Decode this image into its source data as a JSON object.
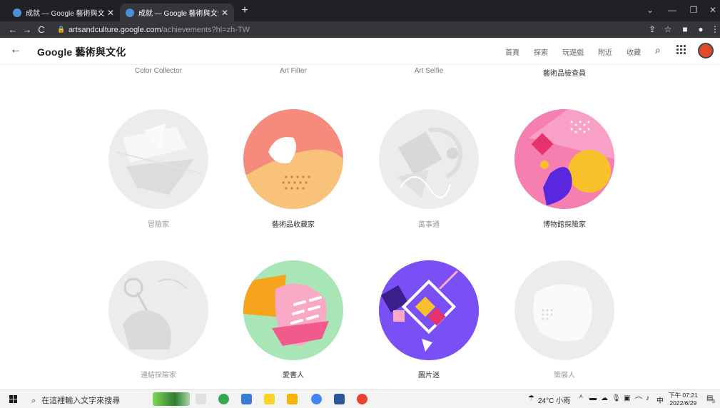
{
  "browser": {
    "tabs": [
      {
        "title": "成就 — Google 藝術與文化",
        "active": false
      },
      {
        "title": "成就 — Google 藝術與文化",
        "active": true
      }
    ],
    "new_tab": "+",
    "url_host": "artsandculture.google.com",
    "url_path": "/achievements?hl=zh-TW"
  },
  "site": {
    "brand": "Google 藝術與文化",
    "nav": [
      "首頁",
      "探索",
      "玩遊戲",
      "附近",
      "收藏"
    ]
  },
  "achievements_top_row": [
    "Color Collector",
    "Art Filter",
    "Art Selfie",
    "藝術品檢查員"
  ],
  "achievements_row1": [
    {
      "name": "冒險家",
      "earned": false
    },
    {
      "name": "藝術品收藏家",
      "earned": true
    },
    {
      "name": "萬事通",
      "earned": false
    },
    {
      "name": "博物館探險家",
      "earned": true
    }
  ],
  "achievements_row2": [
    {
      "name": "連結探險家",
      "earned": false
    },
    {
      "name": "愛書人",
      "earned": true
    },
    {
      "name": "圖片迷",
      "earned": true
    },
    {
      "name": "策展人",
      "earned": false
    }
  ],
  "taskbar": {
    "search_placeholder": "在這裡輸入文字來搜尋",
    "weather": "24°C 小雨",
    "ime": "中",
    "time": "下午 07:21",
    "date": "2022/6/29",
    "notification_count": "3"
  },
  "colors": {
    "tab_bg": "#202124",
    "omnibar_bg": "#35363a",
    "taskbar_bg": "#f3f3f3"
  }
}
